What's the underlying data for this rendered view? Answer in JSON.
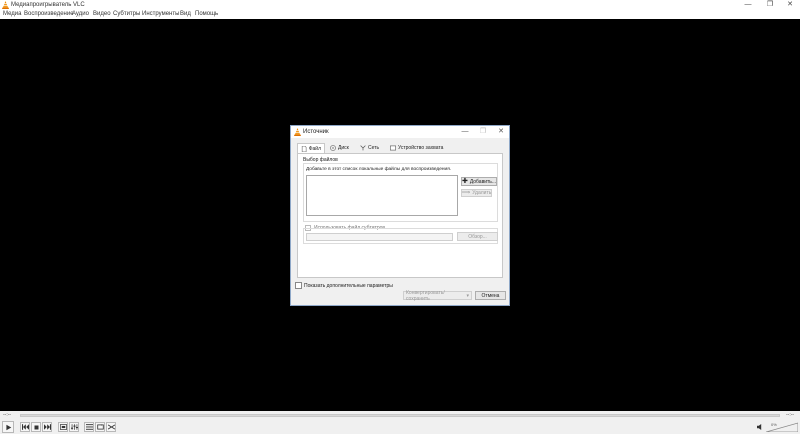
{
  "window": {
    "title": "Медиапроигрыватель VLC",
    "minimize": "—",
    "maximize": "❐",
    "close": "✕"
  },
  "menu": [
    {
      "label": "Медиа"
    },
    {
      "label": "Воспроизведение"
    },
    {
      "label": "Аудио"
    },
    {
      "label": "Видео"
    },
    {
      "label": "Субтитры"
    },
    {
      "label": "Инструменты"
    },
    {
      "label": "Вид"
    },
    {
      "label": "Помощь"
    }
  ],
  "player": {
    "elapsed": "--:--",
    "remaining": "--:--",
    "volume": "0%"
  },
  "dialog": {
    "title": "Источник",
    "tabs": [
      "Файл",
      "Диск",
      "Сеть",
      "Устройство захвата"
    ],
    "file_group_label": "Выбор файлов",
    "file_hint": "Добавьте в этот список локальные файлы для воспроизведения.",
    "add_button": "Добавить...",
    "remove_button": "Удалить",
    "subtitle_checkbox": "Использовать файл субтитров",
    "browse_button": "Обзор...",
    "more_options": "Показать дополнительные параметры",
    "convert_button": "Конвертировать/сохранить",
    "cancel_button": "Отмена"
  }
}
